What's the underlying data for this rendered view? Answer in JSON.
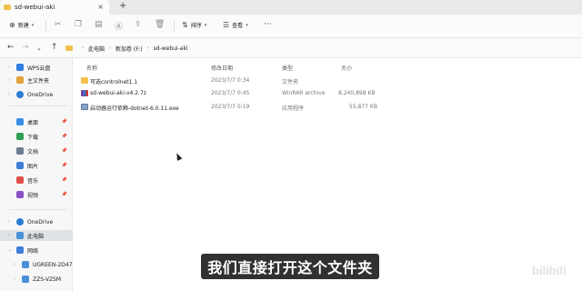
{
  "window": {
    "tab_title": "sd-webui-aki",
    "tab_close": "×",
    "new_tab": "+"
  },
  "toolbar": {
    "new_label": "新建",
    "sort_label": "排序",
    "view_label": "查看",
    "more": "···"
  },
  "address": {
    "crumbs": [
      "此电脑",
      "新加卷 (F:)",
      "sd-webui-aki"
    ],
    "arrow": "›"
  },
  "sidebar": {
    "items": [
      {
        "label": "WPS云盘",
        "color": "#2f7de1"
      },
      {
        "label": "主文件夹",
        "color": "#e2a23a"
      },
      {
        "label": "OneDrive",
        "color": "#2b7cd3"
      },
      {
        "label": "桌面",
        "color": "#3a8ee6"
      },
      {
        "label": "下载",
        "color": "#2f9d53"
      },
      {
        "label": "文档",
        "color": "#6b7c93"
      },
      {
        "label": "图片",
        "color": "#3f7fd8"
      },
      {
        "label": "音乐",
        "color": "#e0504b"
      },
      {
        "label": "视频",
        "color": "#8a4fc4"
      },
      {
        "label": "OneDrive",
        "color": "#2b7cd3"
      },
      {
        "label": "此电脑",
        "color": "#4a8fd8"
      },
      {
        "label": "网络",
        "color": "#3f7fd8"
      },
      {
        "label": "UGREEN-2D47",
        "color": "#4a8fd8"
      },
      {
        "label": "ZZS-VZSM",
        "color": "#4a8fd8"
      }
    ],
    "pin": "📌"
  },
  "columns": {
    "name": "名称",
    "date": "修改日期",
    "type": "类型",
    "size": "大小"
  },
  "files": [
    {
      "name": "可选controlnet1.1",
      "date": "2023/7/7 0:34",
      "type": "文件夹",
      "size": "",
      "icon": "folder-icon"
    },
    {
      "name": "sd-webui-aki-v4.2.7z",
      "date": "2023/7/7 0:45",
      "type": "WinRAR archive",
      "size": "8,240,898 KB",
      "icon": "archive-icon"
    },
    {
      "name": "启动器运行依赖-dotnet-6.0.11.exe",
      "date": "2023/7/7 0:19",
      "type": "应用程序",
      "size": "55,877 KB",
      "icon": "exe-icon"
    }
  ],
  "subtitle": "我们直接打开这个文件夹",
  "watermark": "bilibili"
}
